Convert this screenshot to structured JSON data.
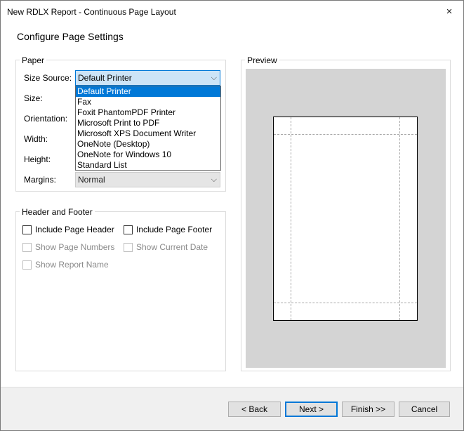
{
  "window": {
    "title": "New RDLX Report - Continuous Page Layout"
  },
  "heading": "Configure Page Settings",
  "paper": {
    "legend": "Paper",
    "size_source_label": "Size Source:",
    "size_source_value": "Default Printer",
    "size_label": "Size:",
    "orientation_label": "Orientation:",
    "width_label": "Width:",
    "height_label": "Height:",
    "margins_label": "Margins:",
    "margins_value": "Normal"
  },
  "dropdown": {
    "items": [
      "Default Printer",
      "Fax",
      "Foxit PhantomPDF Printer",
      "Microsoft Print to PDF",
      "Microsoft XPS Document Writer",
      "OneNote (Desktop)",
      "OneNote for Windows 10",
      "Standard List"
    ],
    "selected": "Default Printer"
  },
  "header_footer": {
    "legend": "Header and Footer",
    "include_page_header": "Include Page Header",
    "include_page_footer": "Include Page Footer",
    "show_page_numbers": "Show Page Numbers",
    "show_current_date": "Show Current Date",
    "show_report_name": "Show Report Name"
  },
  "preview": {
    "legend": "Preview"
  },
  "buttons": {
    "back": "< Back",
    "next": "Next >",
    "finish": "Finish >>",
    "cancel": "Cancel"
  },
  "icons": {
    "close": "×",
    "caret": "⌵"
  },
  "colors": {
    "accent": "#0078d7",
    "selection_bg": "#cce4f7",
    "preview_bg": "#d4d4d4"
  }
}
